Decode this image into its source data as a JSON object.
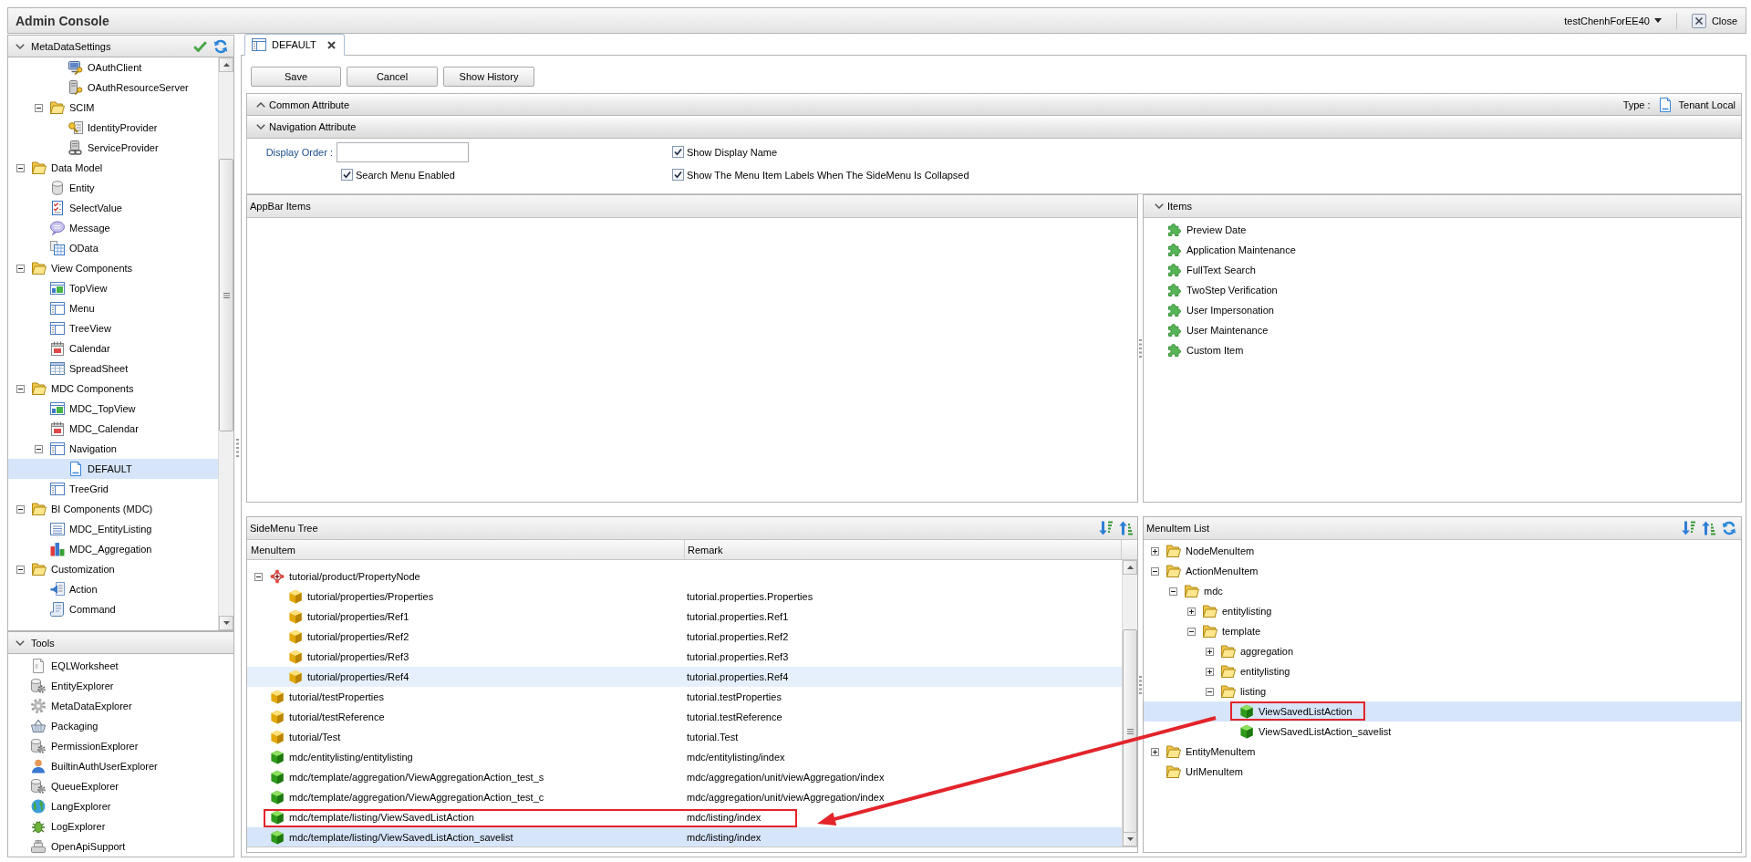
{
  "window": {
    "title": "Admin Console",
    "user": "testChenhForEE40",
    "close_label": "Close"
  },
  "metadata_panel": {
    "title": "MetaDataSettings",
    "expanded": true,
    "tree": [
      {
        "children": [
          {
            "children": [
              {
                "label": "OAuthClient",
                "kind": "client",
                "selected": false
              },
              {
                "label": "OAuthResourceServer",
                "kind": "server",
                "selected": false
              }
            ]
          },
          {
            "label": "SCIM",
            "kind": "folder",
            "expanded": true,
            "selected": false,
            "children": [
              {
                "label": "IdentityProvider",
                "kind": "identity",
                "selected": false
              },
              {
                "label": "ServiceProvider",
                "kind": "service",
                "selected": false
              }
            ]
          }
        ]
      },
      {
        "label": "Data Model",
        "kind": "folder",
        "expanded": true,
        "selected": false,
        "children": [
          {
            "label": "Entity",
            "kind": "entity",
            "selected": false
          },
          {
            "label": "SelectValue",
            "kind": "selectvalue",
            "selected": false
          },
          {
            "label": "Message",
            "kind": "message",
            "selected": false
          },
          {
            "label": "OData",
            "kind": "odata",
            "selected": false
          }
        ]
      },
      {
        "label": "View Components",
        "kind": "folder",
        "expanded": true,
        "selected": false,
        "children": [
          {
            "label": "TopView",
            "kind": "topview",
            "selected": false
          },
          {
            "label": "Menu",
            "kind": "menu",
            "selected": false
          },
          {
            "label": "TreeView",
            "kind": "treeview",
            "selected": false
          },
          {
            "label": "Calendar",
            "kind": "calendar",
            "selected": false
          },
          {
            "label": "SpreadSheet",
            "kind": "spreadsheet",
            "selected": false
          }
        ]
      },
      {
        "label": "MDC Components",
        "kind": "folder",
        "expanded": true,
        "selected": false,
        "children": [
          {
            "label": "MDC_TopView",
            "kind": "topview",
            "selected": false
          },
          {
            "label": "MDC_Calendar",
            "kind": "calendar",
            "selected": false
          },
          {
            "label": "Navigation",
            "kind": "navigation",
            "expanded": true,
            "selected": false,
            "children": [
              {
                "label": "DEFAULT",
                "kind": "definition",
                "selected": true
              }
            ]
          },
          {
            "label": "TreeGrid",
            "kind": "treeview",
            "selected": false
          }
        ]
      },
      {
        "label": "BI Components (MDC)",
        "kind": "folder",
        "expanded": true,
        "selected": false,
        "children": [
          {
            "label": "MDC_EntityListing",
            "kind": "listing",
            "selected": false
          },
          {
            "label": "MDC_Aggregation",
            "kind": "aggregation",
            "selected": false
          }
        ]
      },
      {
        "label": "Customization",
        "kind": "folder",
        "expanded": true,
        "selected": false,
        "children": [
          {
            "label": "Action",
            "kind": "action",
            "selected": false
          },
          {
            "label": "Command",
            "kind": "command",
            "selected": false
          }
        ]
      }
    ]
  },
  "tools_panel": {
    "title": "Tools",
    "expanded": true,
    "items": [
      {
        "label": "EQLWorksheet",
        "kind": "worksheet",
        "selected": false
      },
      {
        "label": "EntityExplorer",
        "kind": "explorer",
        "selected": false
      },
      {
        "label": "MetaDataExplorer",
        "kind": "metadata",
        "selected": false
      },
      {
        "label": "Packaging",
        "kind": "packaging",
        "selected": false
      },
      {
        "label": "PermissionExplorer",
        "kind": "explorer",
        "selected": false
      },
      {
        "label": "BuiltinAuthUserExplorer",
        "kind": "user",
        "selected": false
      },
      {
        "label": "QueueExplorer",
        "kind": "explorer",
        "selected": false
      },
      {
        "label": "LangExplorer",
        "kind": "language",
        "selected": false
      },
      {
        "label": "LogExplorer",
        "kind": "log",
        "selected": false
      },
      {
        "label": "OpenApiSupport",
        "kind": "api",
        "selected": false
      }
    ]
  },
  "tabs": [
    {
      "label": "DEFAULT",
      "selected": true
    }
  ],
  "buttons": [
    "Save",
    "Cancel",
    "Show History"
  ],
  "sections": [
    {
      "title": "Common Attribute",
      "expanded": false,
      "type_label": "Type :",
      "type_value": "Tenant Local"
    },
    {
      "title": "Navigation Attribute",
      "expanded": true,
      "fields": [
        {
          "kind": "text",
          "label": "Display Order :"
        },
        {
          "kind": "checkbox",
          "label": "Show Display Name",
          "checked": true
        },
        {
          "kind": "checkbox",
          "label": "Search Menu Enabled",
          "checked": true
        },
        {
          "kind": "checkbox",
          "label": "Show The Menu Item Labels When The SideMenu Is Collapsed",
          "checked": true
        }
      ]
    }
  ],
  "appbar_panel": {
    "title": "AppBar Items"
  },
  "items_panel": {
    "title": "Items",
    "expanded": true,
    "items": [
      "Preview Date",
      "Application Maintenance",
      "FullText Search",
      "TwoStep Verification",
      "User Impersonation",
      "User Maintenance",
      "Custom Item"
    ]
  },
  "sidemenu_tree": {
    "title": "SideMenu Tree",
    "columns": [
      "MenuItem",
      "Remark"
    ],
    "rows": [
      {
        "label": "tutorial/product/PropertyNode",
        "kind": "node",
        "expanded": true,
        "selected": false,
        "hovered": false,
        "outlined": false,
        "children": [
          {
            "label": "tutorial/properties/Properties",
            "remark": "tutorial.properties.Properties",
            "kind": "entity",
            "selected": false,
            "hovered": false,
            "outlined": false
          },
          {
            "label": "tutorial/properties/Ref1",
            "remark": "tutorial.properties.Ref1",
            "kind": "entity",
            "selected": false,
            "hovered": false,
            "outlined": false
          },
          {
            "label": "tutorial/properties/Ref2",
            "remark": "tutorial.properties.Ref2",
            "kind": "entity",
            "selected": false,
            "hovered": false,
            "outlined": false
          },
          {
            "label": "tutorial/properties/Ref3",
            "remark": "tutorial.properties.Ref3",
            "kind": "entity",
            "selected": false,
            "hovered": false,
            "outlined": false
          },
          {
            "label": "tutorial/properties/Ref4",
            "remark": "tutorial.properties.Ref4",
            "kind": "entity",
            "selected": false,
            "hovered": true,
            "outlined": false
          }
        ]
      },
      {
        "label": "tutorial/testProperties",
        "remark": "tutorial.testProperties",
        "kind": "entity",
        "selected": false,
        "hovered": false,
        "outlined": false
      },
      {
        "label": "tutorial/testReference",
        "remark": "tutorial.testReference",
        "kind": "entity",
        "selected": false,
        "hovered": false,
        "outlined": false
      },
      {
        "label": "tutorial/Test",
        "remark": "tutorial.Test",
        "kind": "entity",
        "selected": false,
        "hovered": false,
        "outlined": false
      },
      {
        "label": "mdc/entitylisting/entitylisting",
        "remark": "mdc/entitylisting/index",
        "kind": "action",
        "selected": false,
        "hovered": false,
        "outlined": false
      },
      {
        "label": "mdc/template/aggregation/ViewAggregationAction_test_s",
        "remark": "mdc/aggregation/unit/viewAggregation/index",
        "kind": "action",
        "selected": false,
        "hovered": false,
        "outlined": false
      },
      {
        "label": "mdc/template/aggregation/ViewAggregationAction_test_c",
        "remark": "mdc/aggregation/unit/viewAggregation/index",
        "kind": "action",
        "selected": false,
        "hovered": false,
        "outlined": false
      },
      {
        "label": "mdc/template/listing/ViewSavedListAction",
        "remark": "mdc/listing/index",
        "kind": "action",
        "selected": false,
        "hovered": false,
        "outlined": true
      },
      {
        "label": "mdc/template/listing/ViewSavedListAction_savelist",
        "remark": "mdc/listing/index",
        "kind": "action",
        "selected": true,
        "hovered": false,
        "outlined": false
      }
    ]
  },
  "menuitem_list": {
    "title": "MenuItem List",
    "tree": [
      {
        "label": "NodeMenuItem",
        "kind": "folder",
        "expanded": false,
        "selected": false,
        "outlined": false
      },
      {
        "label": "ActionMenuItem",
        "kind": "folder",
        "expanded": true,
        "selected": false,
        "outlined": false,
        "children": [
          {
            "label": "mdc",
            "kind": "folder",
            "expanded": true,
            "selected": false,
            "outlined": false,
            "children": [
              {
                "label": "entitylisting",
                "kind": "folder",
                "expanded": false,
                "selected": false,
                "outlined": false
              },
              {
                "label": "template",
                "kind": "folder",
                "expanded": true,
                "selected": false,
                "outlined": false,
                "children": [
                  {
                    "label": "aggregation",
                    "kind": "folder",
                    "expanded": false,
                    "selected": false,
                    "outlined": false
                  },
                  {
                    "label": "entitylisting",
                    "kind": "folder",
                    "expanded": false,
                    "selected": false,
                    "outlined": false
                  },
                  {
                    "label": "listing",
                    "kind": "folder",
                    "expanded": true,
                    "selected": false,
                    "outlined": false,
                    "children": [
                      {
                        "label": "ViewSavedListAction",
                        "kind": "action",
                        "selected": true,
                        "outlined": true
                      },
                      {
                        "label": "ViewSavedListAction_savelist",
                        "kind": "action",
                        "selected": false,
                        "outlined": false
                      }
                    ]
                  }
                ]
              }
            ]
          }
        ]
      },
      {
        "label": "EntityMenuItem",
        "kind": "folder",
        "expanded": false,
        "selected": false,
        "outlined": false
      },
      {
        "label": "UrlMenuItem",
        "kind": "folder",
        "selected": false,
        "outlined": false
      }
    ]
  },
  "annotation_arrow": true
}
